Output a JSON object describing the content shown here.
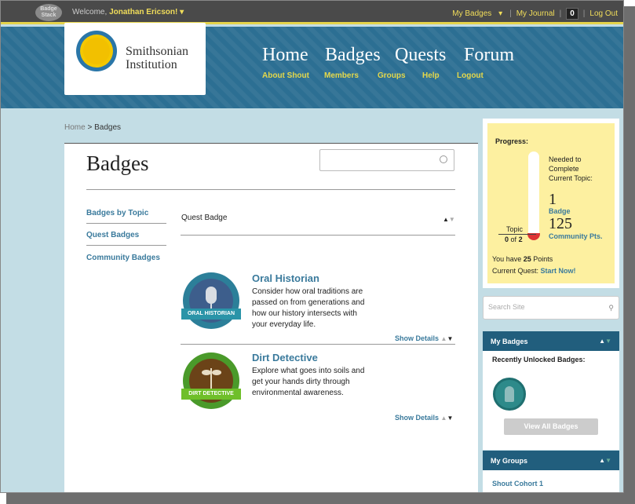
{
  "topbar": {
    "logo_text": "Badge Stack",
    "welcome": "Welcome,",
    "user": "Jonathan Ericson!",
    "my_badges": "My Badges",
    "my_journal": "My Journal",
    "count": "0",
    "logout": "Log Out"
  },
  "header": {
    "logo_line1": "Smithsonian",
    "logo_line2": "Institution",
    "nav": [
      "Home",
      "Badges",
      "Quests",
      "Forum"
    ],
    "subnav": [
      "About Shout",
      "Members",
      "Groups",
      "Help",
      "Logout"
    ]
  },
  "breadcrumb": {
    "home": "Home",
    "current": "> Badges"
  },
  "main": {
    "title": "Badges",
    "search_placeholder": "",
    "side_links": [
      "Badges by Topic",
      "Quest Badges",
      "Community Badges"
    ],
    "section_header": "Quest Badge",
    "badges": [
      {
        "title": "Oral Historian",
        "ribbon": "ORAL HISTORIAN",
        "desc": "Consider how oral traditions are passed on from generations and how our history intersects with your everyday life.",
        "show": "Show Details"
      },
      {
        "title": "Dirt Detective",
        "ribbon": "DIRT DETECTIVE",
        "desc": "Explore what goes into soils and get your hands dirty through environmental awareness.",
        "show": "Show Details"
      }
    ]
  },
  "progress": {
    "label": "Progress:",
    "needed_l1": "Needed to",
    "needed_l2": "Complete",
    "needed_l3": "Current Topic:",
    "badge_num": "1",
    "badge_label": "Badge",
    "pts_num": "125",
    "pts_label": "Community Pts.",
    "topic_label": "Topic",
    "topic_done": "0",
    "topic_of": "of",
    "topic_total": "2",
    "points_pre": "You have",
    "points_val": "25",
    "points_post": "Points",
    "quest_pre": "Current Quest:",
    "quest_link": "Start Now!",
    "fill_fraction": 0.05
  },
  "sidebar": {
    "search_placeholder": "Search Site",
    "my_badges_title": "My Badges",
    "recent_label": "Recently Unlocked Badges:",
    "view_all": "View All Badges",
    "my_groups_title": "My Groups",
    "group_1": "Shout Cohort 1"
  },
  "colors": {
    "header_blue": "#2c6f93",
    "accent_yellow": "#e5d84a",
    "link_blue": "#3a7a9c",
    "panel_blue": "#215e7d"
  }
}
